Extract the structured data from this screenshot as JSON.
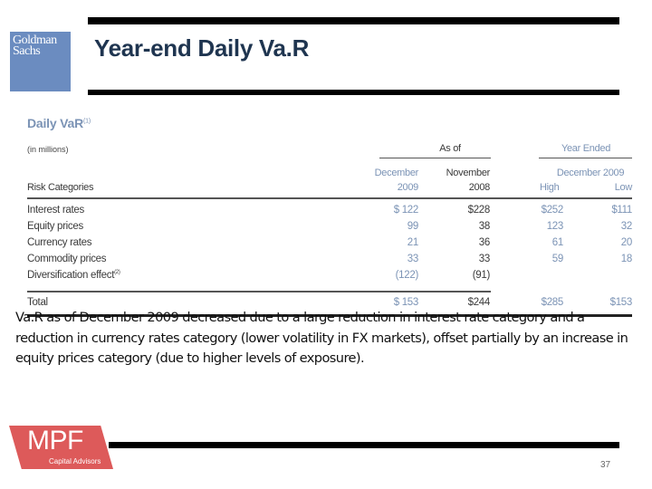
{
  "header": {
    "logo_line1": "Goldman",
    "logo_line2": "Sachs",
    "title": "Year-end Daily Va.R"
  },
  "table": {
    "title": "Daily VaR",
    "title_footnote": "(1)",
    "unit": "(in millions)",
    "group_as_of": "As of",
    "group_year_ended": "Year Ended",
    "col_dec09_line1": "December",
    "col_dec09_line2": "2009",
    "col_nov08_line1": "November",
    "col_nov08_line2": "2008",
    "col_ye_span": "December 2009",
    "col_high": "High",
    "col_low": "Low",
    "row_header": "Risk Categories",
    "rows": [
      {
        "label": "Interest rates",
        "footnote": "",
        "dec09": "$ 122",
        "nov08": "$228",
        "high": "$252",
        "low": "$111"
      },
      {
        "label": "Equity prices",
        "footnote": "",
        "dec09": "99",
        "nov08": "38",
        "high": "123",
        "low": "32"
      },
      {
        "label": "Currency rates",
        "footnote": "",
        "dec09": "21",
        "nov08": "36",
        "high": "61",
        "low": "20"
      },
      {
        "label": "Commodity prices",
        "footnote": "",
        "dec09": "33",
        "nov08": "33",
        "high": "59",
        "low": "18"
      },
      {
        "label": "Diversification effect",
        "footnote": "(2)",
        "dec09": "(122)",
        "nov08": "(91)",
        "high": "",
        "low": ""
      }
    ],
    "total": {
      "label": "Total",
      "dec09": "$ 153",
      "nov08": "$244",
      "high": "$285",
      "low": "$153"
    }
  },
  "commentary": "Va.R as of December 2009 decreased due to a large reduction in interest rate category and a reduction in currency rates category (lower volatility in FX markets), offset partially by an increase in equity prices category (due to higher levels of exposure).",
  "footer": {
    "logo_main": "MPF",
    "logo_sub": "Capital Advisors",
    "page_number": "37"
  },
  "colors": {
    "title": "#1f3550",
    "gs_blue": "#6b8cc0",
    "table_accent": "#7b93b5",
    "mpf_red": "#dd5a5a"
  }
}
